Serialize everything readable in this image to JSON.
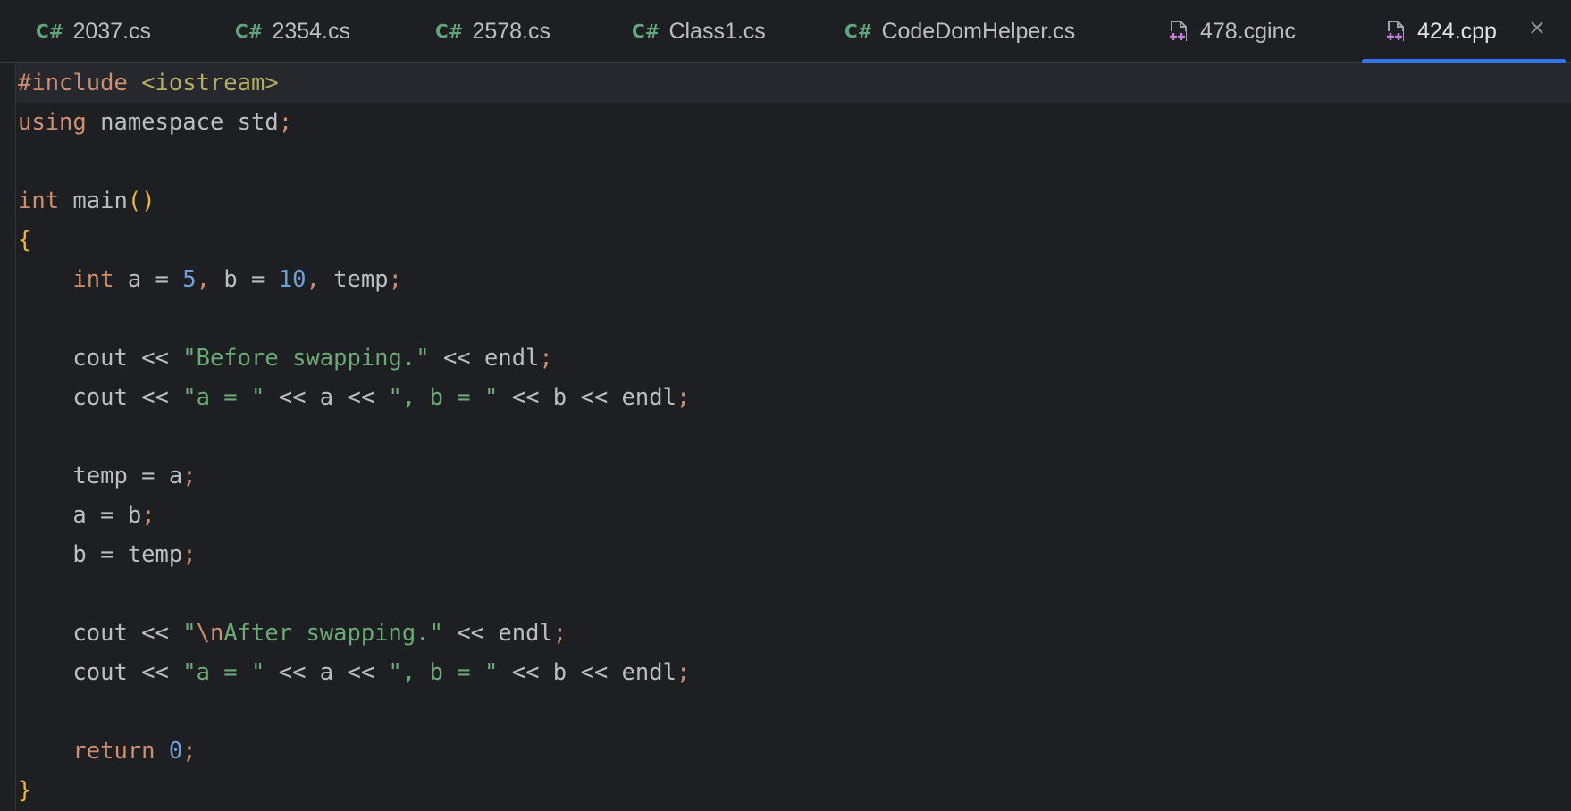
{
  "tabs": [
    {
      "icon": "csharp-file-icon",
      "icon_text": "C#",
      "label": "2037.cs"
    },
    {
      "icon": "csharp-file-icon",
      "icon_text": "C#",
      "label": "2354.cs"
    },
    {
      "icon": "csharp-file-icon",
      "icon_text": "C#",
      "label": "2578.cs"
    },
    {
      "icon": "csharp-file-icon",
      "icon_text": "C#",
      "label": "Class1.cs"
    },
    {
      "icon": "csharp-file-icon",
      "icon_text": "C#",
      "label": "CodeDomHelper.cs"
    },
    {
      "icon": "cpp-file-icon",
      "icon_text": "",
      "label": "478.cginc"
    },
    {
      "icon": "cpp-file-icon",
      "icon_text": "",
      "label": "424.cpp",
      "active": true,
      "closable": true
    }
  ],
  "colors": {
    "background": "#1e1f22",
    "accent": "#3574f0",
    "keyword": "#cf8e6d",
    "string": "#6aab73",
    "number": "#6f9fd8",
    "brace": "#e8ba36",
    "text": "#bcbec4"
  },
  "code": {
    "language": "cpp",
    "lines": [
      "#include <iostream>",
      "using namespace std;",
      "",
      "int main()",
      "{",
      "    int a = 5, b = 10, temp;",
      "",
      "    cout << \"Before swapping.\" << endl;",
      "    cout << \"a = \" << a << \", b = \" << b << endl;",
      "",
      "    temp = a;",
      "    a = b;",
      "    b = temp;",
      "",
      "    cout << \"\\nAfter swapping.\" << endl;",
      "    cout << \"a = \" << a << \", b = \" << b << endl;",
      "",
      "    return 0;",
      "}"
    ]
  },
  "tokens": {
    "l0_kw": "#include",
    "l0_inc": "<iostream>",
    "l1_using": "using",
    "l1_ns": "namespace std",
    "l1_semi": ";",
    "l3_int": "int",
    "l3_main": "main",
    "l3_parens": "()",
    "l4_brace": "{",
    "l5_int": "int",
    "l5_a": "a = ",
    "l5_5": "5",
    "l5_comma1": ",",
    "l5_b": " b = ",
    "l5_10": "10",
    "l5_comma2": ",",
    "l5_temp": " temp",
    "l5_semi": ";",
    "l7_cout": "cout << ",
    "l7_str": "\"Before swapping.\"",
    "l7_rest": " << endl",
    "l7_semi": ";",
    "l8_cout": "cout << ",
    "l8_str1": "\"a = \"",
    "l8_mid1": " << a << ",
    "l8_str2": "\", b = \"",
    "l8_mid2": " << b << endl",
    "l8_semi": ";",
    "l10_text": "temp = a",
    "l10_semi": ";",
    "l11_text": "a = b",
    "l11_semi": ";",
    "l12_text": "b = temp",
    "l12_semi": ";",
    "l14_cout": "cout << ",
    "l14_q1": "\"",
    "l14_esc": "\\n",
    "l14_str": "After swapping.\"",
    "l14_rest": " << endl",
    "l14_semi": ";",
    "l15_cout": "cout << ",
    "l15_str1": "\"a = \"",
    "l15_mid1": " << a << ",
    "l15_str2": "\", b = \"",
    "l15_mid2": " << b << endl",
    "l15_semi": ";",
    "l17_return": "return",
    "l17_sp": " ",
    "l17_0": "0",
    "l17_semi": ";",
    "l18_brace": "}"
  }
}
